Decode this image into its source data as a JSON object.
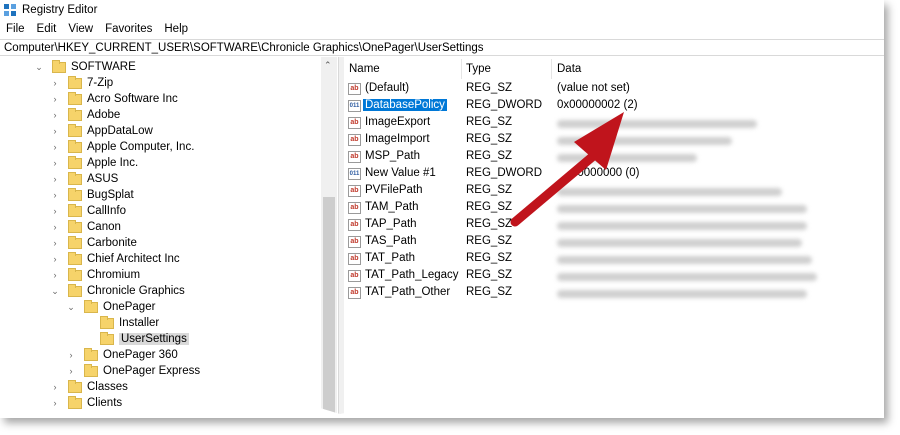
{
  "window": {
    "title": "Registry Editor"
  },
  "menu": [
    "File",
    "Edit",
    "View",
    "Favorites",
    "Help"
  ],
  "address": "Computer\\HKEY_CURRENT_USER\\SOFTWARE\\Chronicle Graphics\\OnePager\\UserSettings",
  "tree": [
    {
      "label": "SOFTWARE",
      "expanded": true
    },
    {
      "label": "7-Zip"
    },
    {
      "label": "Acro Software Inc"
    },
    {
      "label": "Adobe"
    },
    {
      "label": "AppDataLow"
    },
    {
      "label": "Apple Computer, Inc."
    },
    {
      "label": "Apple Inc."
    },
    {
      "label": "ASUS"
    },
    {
      "label": "BugSplat"
    },
    {
      "label": "CallInfo"
    },
    {
      "label": "Canon"
    },
    {
      "label": "Carbonite"
    },
    {
      "label": "Chief Architect Inc"
    },
    {
      "label": "Chromium"
    },
    {
      "label": "Chronicle Graphics",
      "expanded": true
    },
    {
      "label": "OnePager",
      "expanded": true
    },
    {
      "label": "Installer"
    },
    {
      "label": "UserSettings",
      "selected": true
    },
    {
      "label": "OnePager 360"
    },
    {
      "label": "OnePager Express"
    },
    {
      "label": "Classes"
    },
    {
      "label": "Clients"
    }
  ],
  "columns": {
    "name": "Name",
    "type": "Type",
    "data": "Data"
  },
  "values": [
    {
      "name": "(Default)",
      "type": "REG_SZ",
      "data": "(value not set)",
      "icon": "string-value-icon"
    },
    {
      "name": "DatabasePolicy",
      "type": "REG_DWORD",
      "data": "0x00000002 (2)",
      "icon": "dword-value-icon",
      "selected": true
    },
    {
      "name": "ImageExport",
      "type": "REG_SZ",
      "data": "",
      "icon": "string-value-icon"
    },
    {
      "name": "ImageImport",
      "type": "REG_SZ",
      "data": "",
      "icon": "string-value-icon"
    },
    {
      "name": "MSP_Path",
      "type": "REG_SZ",
      "data": "",
      "icon": "string-value-icon"
    },
    {
      "name": "New Value #1",
      "type": "REG_DWORD",
      "data": "00000000 (0)",
      "icon": "dword-value-icon"
    },
    {
      "name": "PVFilePath",
      "type": "REG_SZ",
      "data": "",
      "icon": "string-value-icon"
    },
    {
      "name": "TAM_Path",
      "type": "REG_SZ",
      "data": "",
      "icon": "string-value-icon"
    },
    {
      "name": "TAP_Path",
      "type": "REG_SZ",
      "data": "",
      "icon": "string-value-icon"
    },
    {
      "name": "TAS_Path",
      "type": "REG_SZ",
      "data": "",
      "icon": "string-value-icon"
    },
    {
      "name": "TAT_Path",
      "type": "REG_SZ",
      "data": "",
      "icon": "string-value-icon"
    },
    {
      "name": "TAT_Path_Legacy",
      "type": "REG_SZ",
      "data": "",
      "icon": "string-value-icon"
    },
    {
      "name": "TAT_Path_Other",
      "type": "REG_SZ",
      "data": "",
      "icon": "string-value-icon"
    }
  ],
  "colors": {
    "selection": "#0078d7",
    "arrow": "#c0141c",
    "folder": "#f6d36a"
  }
}
